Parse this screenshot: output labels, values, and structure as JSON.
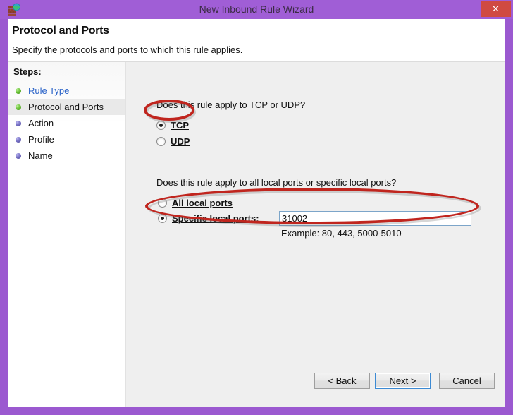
{
  "window": {
    "title": "New Inbound Rule Wizard",
    "icon": "firewall-brick-globe-icon",
    "close_label": "✕",
    "title_bar_color": "#a05ed6",
    "frame_color": "#9b59d0",
    "close_button_color": "#d04a42"
  },
  "header": {
    "title": "Protocol and Ports",
    "subtitle": "Specify the protocols and ports to which this rule applies."
  },
  "sidebar": {
    "label": "Steps:",
    "items": [
      {
        "label": "Rule Type",
        "state": "done",
        "selected": false,
        "link": true
      },
      {
        "label": "Protocol and Ports",
        "state": "done",
        "selected": true,
        "link": false
      },
      {
        "label": "Action",
        "state": "todo",
        "selected": false,
        "link": false
      },
      {
        "label": "Profile",
        "state": "todo",
        "selected": false,
        "link": false
      },
      {
        "label": "Name",
        "state": "todo",
        "selected": false,
        "link": false
      }
    ]
  },
  "main": {
    "protocol_question": "Does this rule apply to TCP or UDP?",
    "protocol_options": [
      {
        "label": "TCP",
        "checked": true
      },
      {
        "label": "UDP",
        "checked": false
      }
    ],
    "ports_question": "Does this rule apply to all local ports or specific local ports?",
    "ports_options": [
      {
        "label": "All local ports",
        "checked": false
      },
      {
        "label": "Specific local ports:",
        "checked": true
      }
    ],
    "port_value": "31002",
    "port_example": "Example: 80, 443, 5000-5010"
  },
  "footer": {
    "back_label": "< Back",
    "next_label": "Next >",
    "cancel_label": "Cancel",
    "focused_button": "Next >"
  },
  "annotations": {
    "color": "#c0251e",
    "highlights": [
      "TCP radio option",
      "Specific local ports row with port value"
    ]
  }
}
